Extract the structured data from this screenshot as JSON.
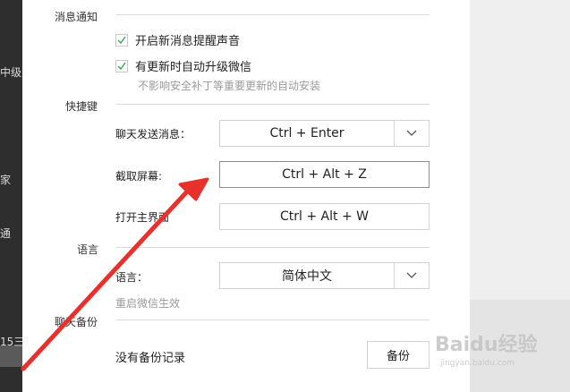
{
  "sidebar": {
    "fragments": [
      "中级人",
      "家",
      "通",
      "15三"
    ]
  },
  "notifications": {
    "title": "消息通知",
    "options": [
      {
        "label": "开启新消息提醒声音",
        "checked": true
      },
      {
        "label": "有更新时自动升级微信",
        "checked": true
      }
    ],
    "hint": "不影响安全补丁等重要更新的自动安装"
  },
  "shortcuts": {
    "title": "快捷键",
    "send": {
      "label": "聊天发送消息：",
      "value": "Ctrl + Enter"
    },
    "screenshot": {
      "label": "截取屏幕:",
      "value": "Ctrl + Alt + Z"
    },
    "open_main": {
      "label": "打开主界面",
      "value": "Ctrl + Alt + W"
    }
  },
  "language": {
    "title": "语言",
    "label": "语言：",
    "value": "简体中文",
    "hint": "重启微信生效"
  },
  "backup": {
    "title": "聊天备份",
    "status": "没有备份记录",
    "button": "备份"
  },
  "watermark": {
    "text": "Baidu经验",
    "url": "jingyan.baidu.com"
  },
  "colors": {
    "check": "#3aa55a",
    "arrow": "#e8302c",
    "sidebar_bg": "#2e2e2e"
  }
}
